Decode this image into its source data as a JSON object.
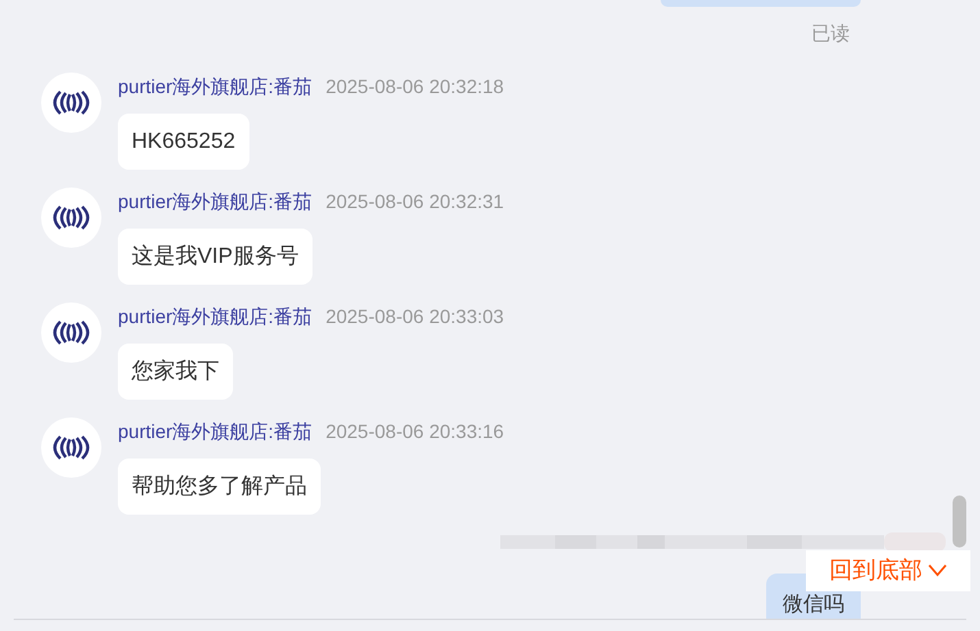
{
  "read_receipt": "已读",
  "messages": [
    {
      "sender": "purtier海外旗舰店:番茄",
      "time": "2025-08-06 20:32:18",
      "text": "HK665252"
    },
    {
      "sender": "purtier海外旗舰店:番茄",
      "time": "2025-08-06 20:32:31",
      "text": "这是我VIP服务号"
    },
    {
      "sender": "purtier海外旗舰店:番茄",
      "time": "2025-08-06 20:33:03",
      "text": "您家我下"
    },
    {
      "sender": "purtier海外旗舰店:番茄",
      "time": "2025-08-06 20:33:16",
      "text": "帮助您多了解产品"
    }
  ],
  "own_message": {
    "text": "微信吗"
  },
  "back_to_bottom": {
    "label": "回到底部"
  }
}
